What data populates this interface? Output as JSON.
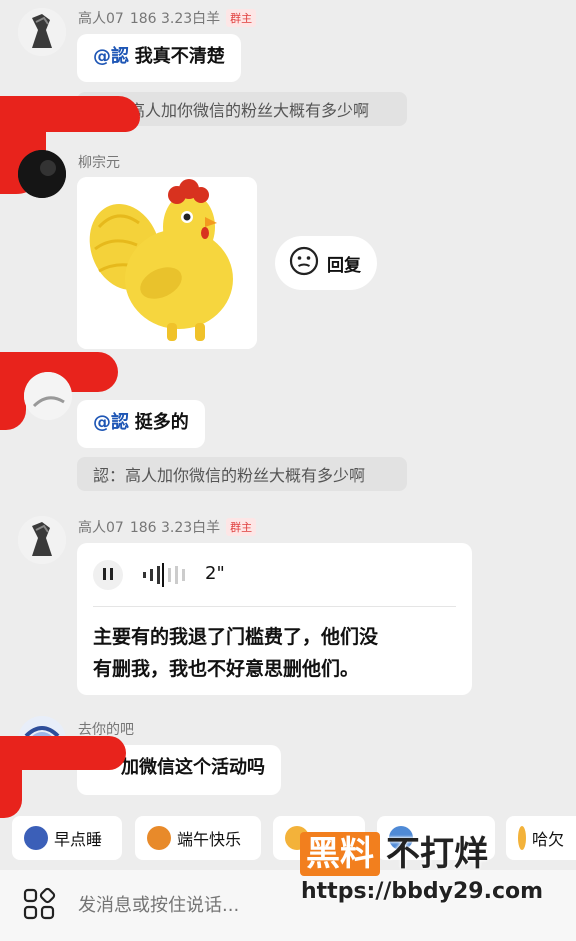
{
  "messages": [
    {
      "name": "高人07",
      "meta": "186 3.23白羊",
      "badge": "群主",
      "mention": "@認",
      "text": "我真不清楚"
    },
    {
      "quote": "高人加你微信的粉丝大概有多少啊"
    },
    {
      "name": "柳宗元"
    },
    {
      "reply_label": "回复"
    },
    {
      "mention": "@認",
      "text": "挺多的"
    },
    {
      "quote": "認：高人加你微信的粉丝大概有多少啊"
    },
    {
      "name": "高人07",
      "meta": "186 3.23白羊",
      "badge": "群主",
      "voice_duration": "2\"",
      "transcript_line1": "主要有的我退了门槛费了，他们没",
      "transcript_line2": "有删我，我也不好意思删他们。"
    },
    {
      "name": "去你的吧",
      "text": "加微信这个活动吗"
    }
  ],
  "quick_chips": [
    "早点睡",
    "端午快乐",
    "",
    "",
    "哈欠"
  ],
  "input": {
    "placeholder": "发消息或按住说话..."
  },
  "watermark": {
    "brand_part1": "黑料",
    "brand_part2": "不打烊",
    "url": "https://bbdy29.com"
  },
  "colors": {
    "mention": "#1e56b5",
    "badge": "#e0403f",
    "redact": "#e8231c"
  }
}
